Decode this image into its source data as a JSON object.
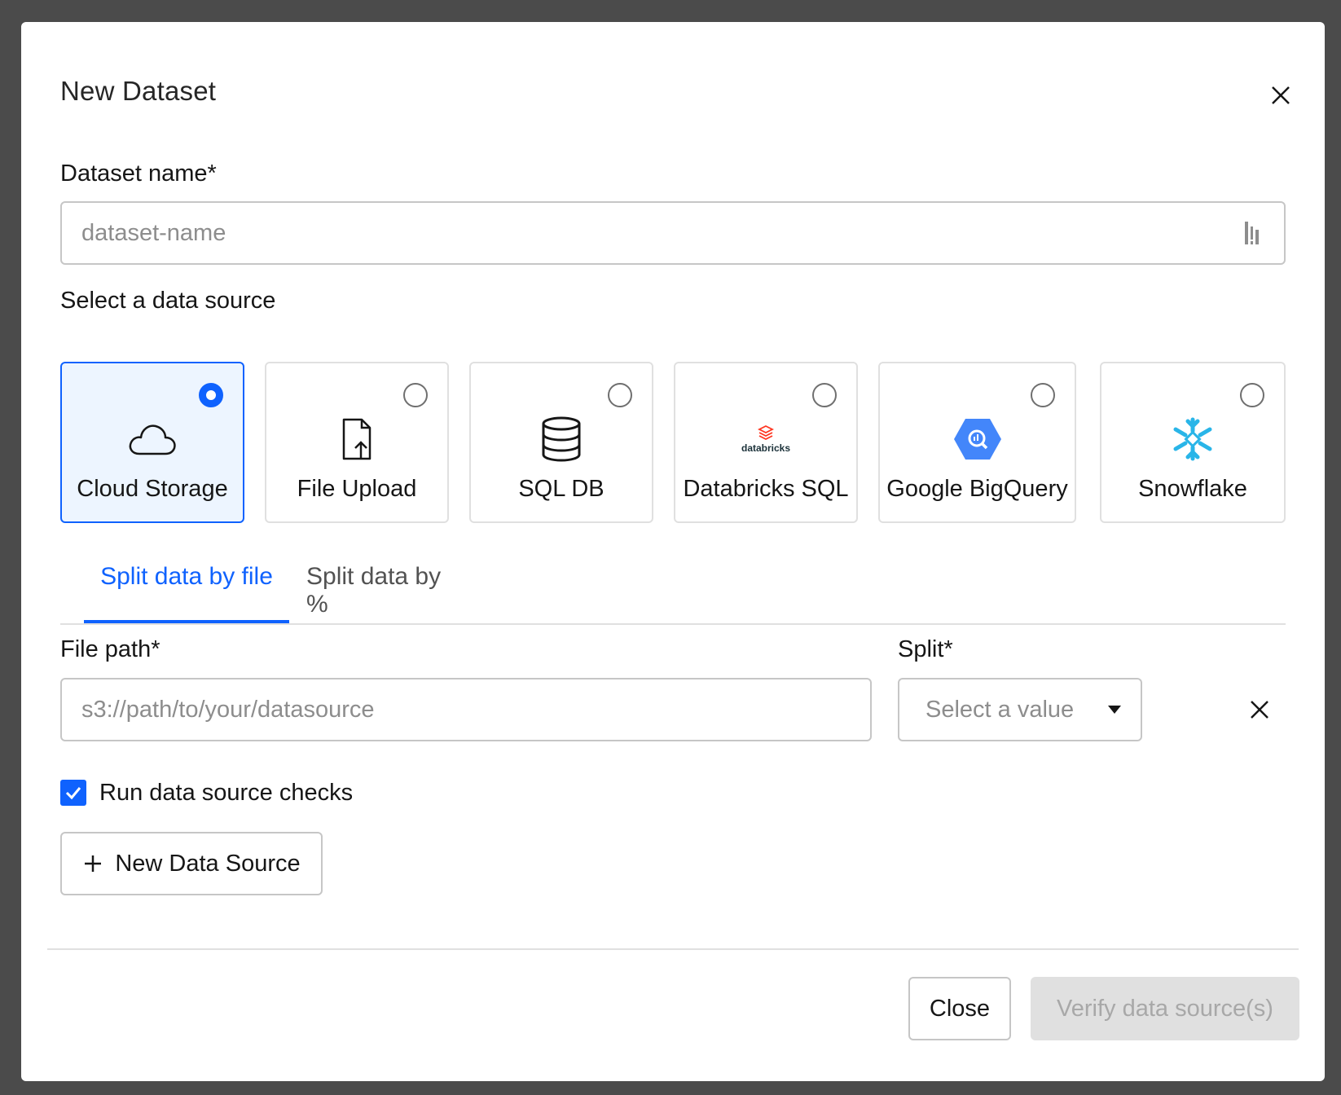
{
  "modal": {
    "title": "New Dataset"
  },
  "dataset_name": {
    "label": "Dataset name*",
    "placeholder": "dataset-name"
  },
  "data_source": {
    "label": "Select a data source",
    "options": [
      {
        "label": "Cloud Storage",
        "icon": "cloud-icon",
        "selected": true
      },
      {
        "label": "File Upload",
        "icon": "file-upload-icon",
        "selected": false
      },
      {
        "label": "SQL DB",
        "icon": "database-icon",
        "selected": false
      },
      {
        "label": "Databricks SQL",
        "icon": "databricks-logo",
        "logo_text": "databricks",
        "selected": false
      },
      {
        "label": "Google BigQuery",
        "icon": "bigquery-logo",
        "selected": false
      },
      {
        "label": "Snowflake",
        "icon": "snowflake-logo",
        "selected": false
      }
    ]
  },
  "tabs": [
    {
      "label": "Split data by file",
      "active": true
    },
    {
      "label": "Split data by %",
      "active": false
    }
  ],
  "file_path": {
    "label": "File path*",
    "placeholder": "s3://path/to/your/datasource"
  },
  "split": {
    "label": "Split*",
    "placeholder": "Select a value"
  },
  "checks": {
    "label": "Run data source checks",
    "checked": true
  },
  "new_source_button": {
    "label": "New Data Source"
  },
  "footer": {
    "close_label": "Close",
    "verify_label": "Verify data source(s)"
  },
  "colors": {
    "accent": "#0f62fe",
    "snowflake": "#29b5e8",
    "bigquery": "#4386fa",
    "databricks": "#ff3621"
  }
}
